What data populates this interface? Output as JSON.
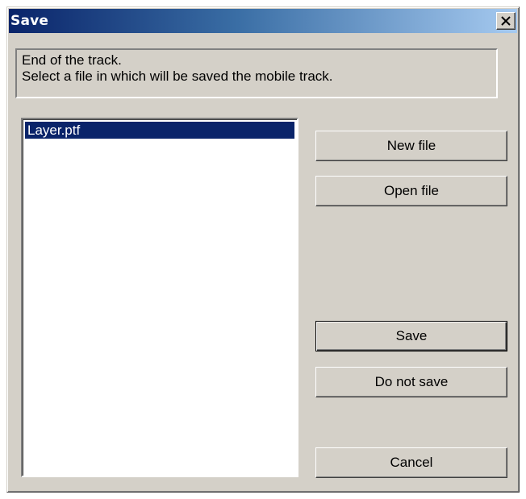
{
  "window": {
    "title": "Save",
    "close_glyph": "✕"
  },
  "message": {
    "line1": "End of the track.",
    "line2": "Select a file in which will be saved the mobile track."
  },
  "file_list": {
    "items": [
      "Layer.ptf"
    ],
    "selected_index": 0
  },
  "buttons": {
    "new_file": "New file",
    "open_file": "Open file",
    "save": "Save",
    "do_not_save": "Do not save",
    "cancel": "Cancel"
  },
  "colors": {
    "dialog_face": "#d4d0c8",
    "titlebar_start": "#0a246a",
    "titlebar_end": "#a6caf0",
    "selection": "#0a246a"
  }
}
